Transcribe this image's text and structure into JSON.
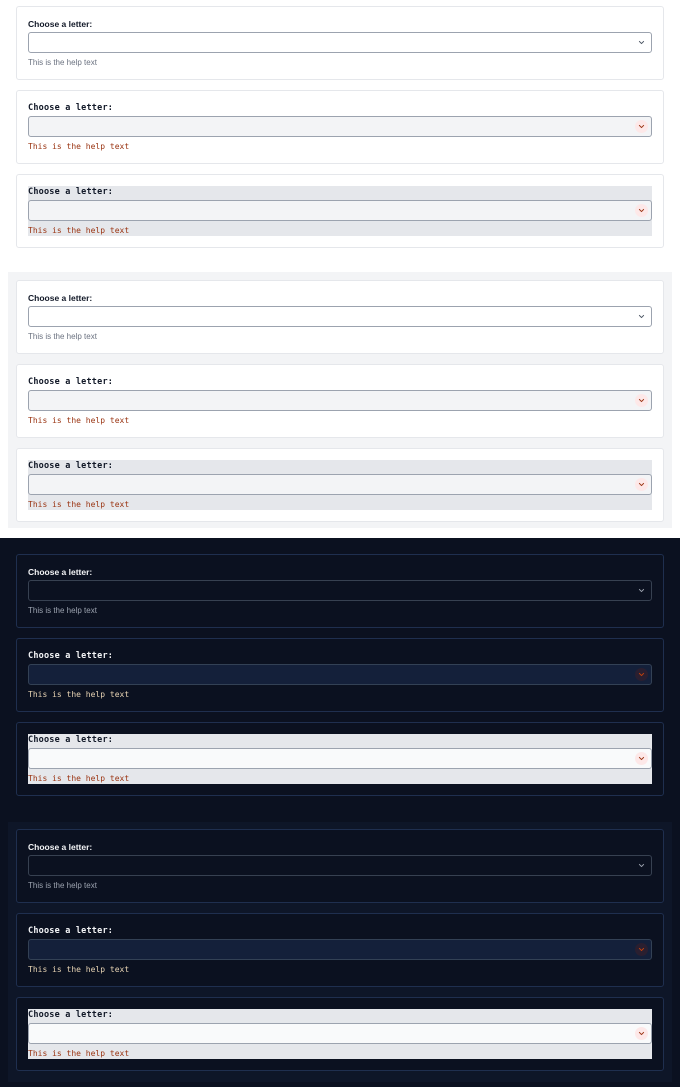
{
  "fields": {
    "label": "Choose a letter:",
    "help": "This is the help text",
    "value": ""
  },
  "colors": {
    "light_bg": "#ffffff",
    "dark_bg": "#0b1120",
    "help_error": "#9a3412",
    "chevron_dark": "#9ca3af",
    "chevron_light": "#4b5563",
    "chevron_error": "#9a3412"
  },
  "icons": {
    "chevron": "chevron-down-icon"
  }
}
